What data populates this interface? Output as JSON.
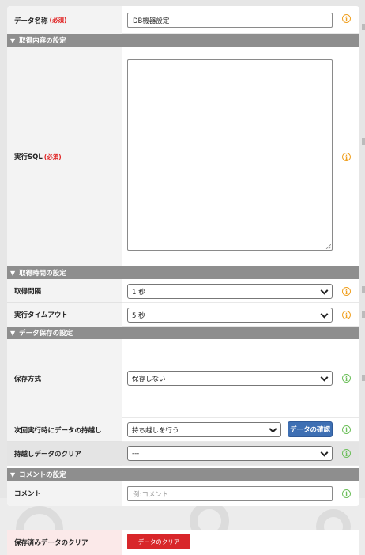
{
  "fields": {
    "data_name": {
      "label": "データ名称",
      "required": "(必須)",
      "value": "DB機器設定"
    },
    "sql": {
      "label": "実行SQL",
      "required": "(必須)",
      "value": ""
    },
    "interval": {
      "label": "取得間隔",
      "value": "1 秒"
    },
    "timeout": {
      "label": "実行タイムアウト",
      "value": "5 秒"
    },
    "save_method": {
      "label": "保存方式",
      "value": "保存しない"
    },
    "carry_over": {
      "label": "次回実行時にデータの持越し",
      "value": "持ち越しを行う",
      "button": "データの確認"
    },
    "carry_clear": {
      "label": "持越しデータのクリア",
      "value": "---"
    },
    "comment": {
      "label": "コメント",
      "placeholder": "例:コメント"
    }
  },
  "sections": {
    "acquisition": "取得内容の設定",
    "timing": "取得時間の設定",
    "storage": "データ保存の設定",
    "comment": "コメントの設定"
  },
  "section_arrow": "▼",
  "info_glyph": "i",
  "saved_clear": {
    "label": "保存済みデータのクリア",
    "button": "データのクリア"
  },
  "colors": {
    "section_header": "#8e8e8e",
    "required": "#e02020",
    "info_orange": "#f0a020",
    "info_green": "#6cbf5a",
    "confirm_button": "#3e6fb3",
    "clear_button": "#d8262a"
  }
}
